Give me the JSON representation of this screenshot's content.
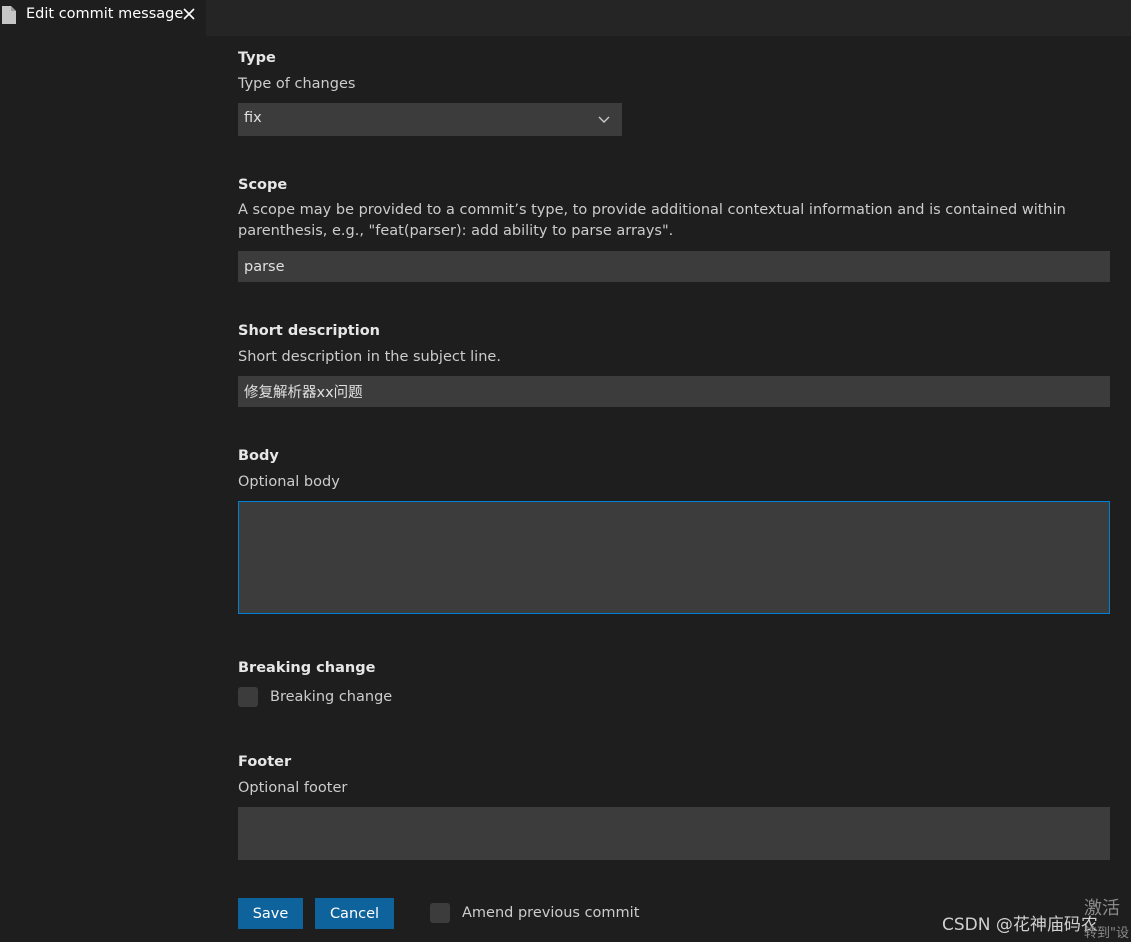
{
  "tab": {
    "title": "Edit commit message",
    "file_icon": "file-icon",
    "close_icon": "close-icon"
  },
  "form": {
    "type": {
      "title": "Type",
      "description": "Type of changes",
      "value": "fix"
    },
    "scope": {
      "title": "Scope",
      "description": "A scope may be provided to a commit’s type, to provide additional contextual information and is contained within parenthesis, e.g., \"feat(parser): add ability to parse arrays\".",
      "value": "parse"
    },
    "short_description": {
      "title": "Short description",
      "description": "Short description in the subject line.",
      "value": "修复解析器xx问题"
    },
    "body": {
      "title": "Body",
      "description": "Optional body",
      "value": ""
    },
    "breaking_change": {
      "title": "Breaking change",
      "checkbox_label": "Breaking change",
      "checked": false
    },
    "footer": {
      "title": "Footer",
      "description": "Optional footer",
      "value": ""
    }
  },
  "actions": {
    "save_label": "Save",
    "cancel_label": "Cancel",
    "amend_label": "Amend previous commit",
    "amend_checked": false
  },
  "watermark": {
    "text": "CSDN @花神庙码农",
    "activate_line1": "激活",
    "activate_line2": "转到\"设"
  },
  "colors": {
    "background": "#1e1e1e",
    "input_background": "#3c3c3c",
    "focus_border": "#007fd4",
    "button_background": "#0e639c"
  }
}
